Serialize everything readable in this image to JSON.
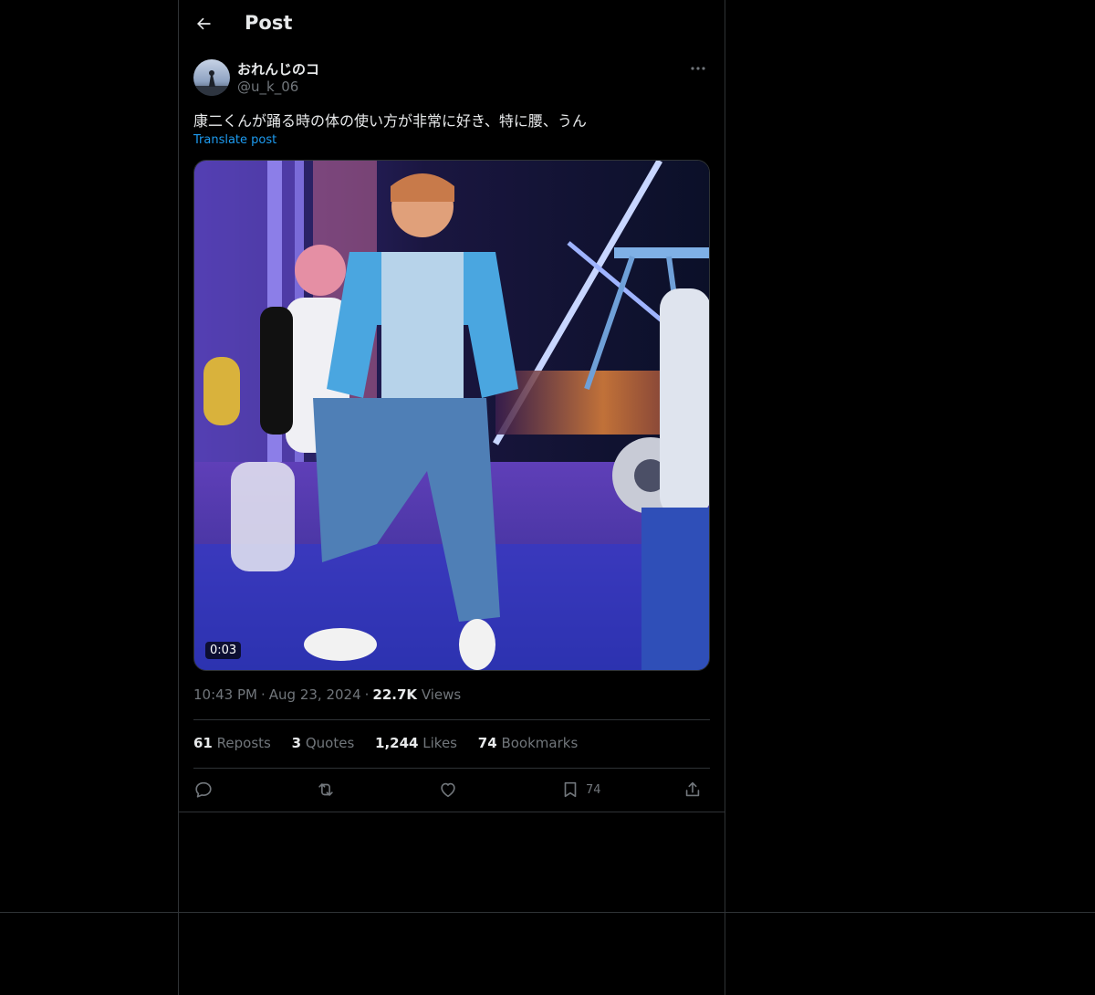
{
  "header": {
    "title": "Post",
    "back_icon": "arrow-left-icon"
  },
  "author": {
    "display_name": "おれんじのコ",
    "handle": "@u_k_06",
    "more_icon": "ellipsis-icon"
  },
  "post": {
    "text": "康二くんが踊る時の体の使い方が非常に好き、特に腰、うん",
    "translate_label": "Translate post",
    "media": {
      "type": "video",
      "duration": "0:03"
    }
  },
  "meta": {
    "time": "10:43 PM",
    "separator": "·",
    "date": "Aug 23, 2024",
    "views_count": "22.7K",
    "views_label": "Views"
  },
  "stats": {
    "reposts_count": "61",
    "reposts_label": "Reposts",
    "quotes_count": "3",
    "quotes_label": "Quotes",
    "likes_count": "1,244",
    "likes_label": "Likes",
    "bookmarks_count": "74",
    "bookmarks_label": "Bookmarks"
  },
  "actions": {
    "reply_icon": "reply-icon",
    "repost_icon": "repost-icon",
    "like_icon": "heart-icon",
    "bookmark_icon": "bookmark-icon",
    "bookmark_count": "74",
    "share_icon": "share-icon"
  },
  "colors": {
    "background": "#000000",
    "text_primary": "#e7e9ea",
    "text_secondary": "#71767b",
    "accent": "#1d9bf0",
    "border": "#2f3336"
  }
}
